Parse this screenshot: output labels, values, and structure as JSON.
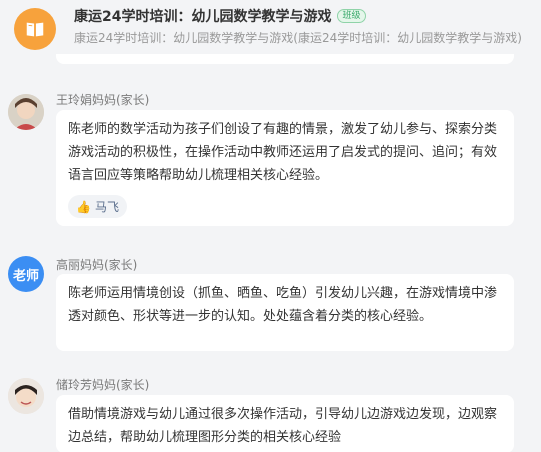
{
  "header": {
    "course_icon": "book-icon",
    "title": "康运24学时培训：幼儿园数学教学与游戏",
    "badge": "班级",
    "subtitle": "康运24学时培训：幼儿园数学教学与游戏(康运24学时培训：幼儿园数学教学与游戏)"
  },
  "comments": [
    {
      "username": "王玲娟妈妈(家长)",
      "avatar": "user-photo",
      "text": "陈老师的数学活动为孩子们创设了有趣的情景，激发了幼儿参与、探索分类游戏活动的积极性，在操作活动中教师还运用了启发式的提问、追问；有效语言回应等策略帮助幼儿梳理相关核心经验。",
      "likes": [
        "马飞"
      ]
    },
    {
      "username": "高丽妈妈(家长)",
      "avatar_text": "老师",
      "text": "陈老师运用情境创设（抓鱼、晒鱼、吃鱼）引发幼儿兴趣，在游戏情境中渗透对颜色、形状等进一步的认知。处处蕴含着分类的核心经验。"
    },
    {
      "username": "储玲芳妈妈(家长)",
      "avatar": "user-photo",
      "text": "借助情境游戏与幼儿通过很多次操作活动，引导幼儿边游戏边发现，边观察边总结，帮助幼儿梳理图形分类的相关核心经验"
    }
  ],
  "colors": {
    "accent": "#f7a23c",
    "badge_green": "#39a96b",
    "avatar_blue": "#3b8ef3"
  }
}
